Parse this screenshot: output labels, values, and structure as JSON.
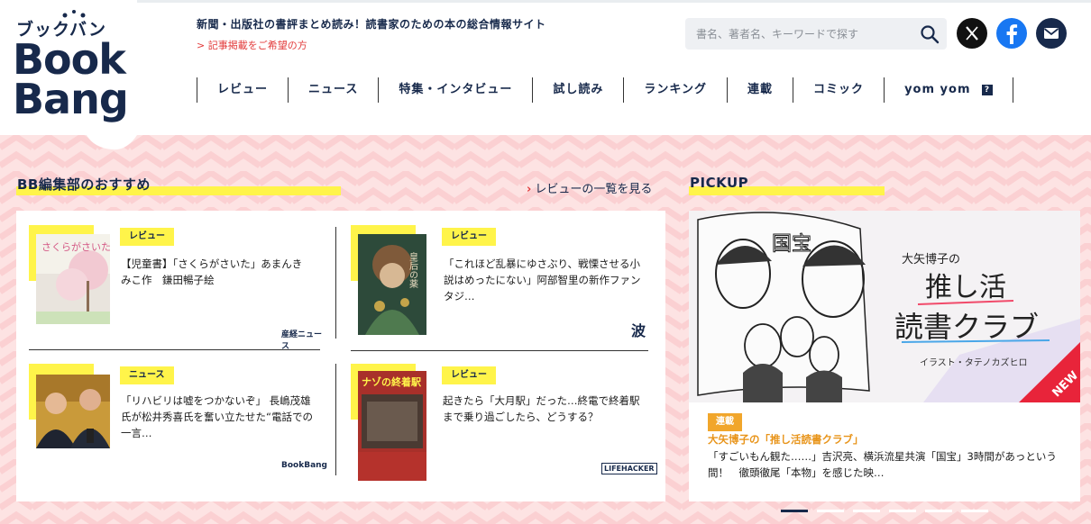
{
  "logo": {
    "kana": "ブックバン",
    "wordmark_line1": "Book",
    "wordmark_line2": "Bang"
  },
  "header": {
    "tagline": "新聞・出版社の書評まとめ読み！読書家のための本の総合情報サイト",
    "request_link": "> 記事掲載をご希望の方",
    "search_placeholder": "書名、著者名、キーワードで探す"
  },
  "social": [
    "x-icon",
    "facebook-icon",
    "mail-icon"
  ],
  "nav": [
    {
      "label": "レビュー"
    },
    {
      "label": "ニュース"
    },
    {
      "label": "特集・インタビュー"
    },
    {
      "label": "試し読み"
    },
    {
      "label": "ランキング"
    },
    {
      "label": "連載"
    },
    {
      "label": "コミック"
    },
    {
      "label": "yom yom",
      "badge": "?"
    }
  ],
  "recommend": {
    "title": "BB編集部のおすすめ",
    "more_link": "レビューの一覧を見る",
    "cards": [
      {
        "badge": "レビュー",
        "text": "【児童書】「さくらがさいた」あまんきみこ作　鎌田暢子絵",
        "source": "産経ニュース",
        "thumb_title": "さくらがさいた"
      },
      {
        "badge": "レビュー",
        "text": "「これほど乱暴にゆさぶり、戦慄させる小説はめったにない」阿部智里の新作ファンタジ…",
        "source": "波",
        "thumb_title": "皇后の薬"
      },
      {
        "badge": "ニュース",
        "text": "「リハビリは嘘をつかないぞ」 長嶋茂雄氏が松井秀喜氏を奮い立たせた“電話での一言…",
        "source": "BookBang"
      },
      {
        "badge": "レビュー",
        "text": "起きたら「大月駅」だった…終電で終着駅まで乗り過ごしたら、どうする？",
        "source": "LIFEHACKER",
        "thumb_title": "ナゾの終着駅"
      }
    ]
  },
  "pickup": {
    "title": "PICKUP",
    "art": {
      "kanji": "国宝",
      "headline_small": "大矢博子の",
      "headline_line1": "推し活",
      "headline_line2": "読書クラブ",
      "credit": "イラスト・タテノカズヒロ",
      "new_label": "NEW"
    },
    "badge": "連載",
    "series": "大矢博子の「推し活読書クラブ」",
    "text": "「すごいもん観た……」吉沢亮、横浜流星共演「国宝」3時間があっという間！　徹頭徹尾「本物」を感じた映…",
    "page_count": 6,
    "active_page": 1
  },
  "colors": {
    "navy": "#17294b",
    "accent_yellow": "#fff44a",
    "link_red": "#e23a3a",
    "background_pink": "#fde3e3",
    "series_orange": "#e8941a"
  }
}
